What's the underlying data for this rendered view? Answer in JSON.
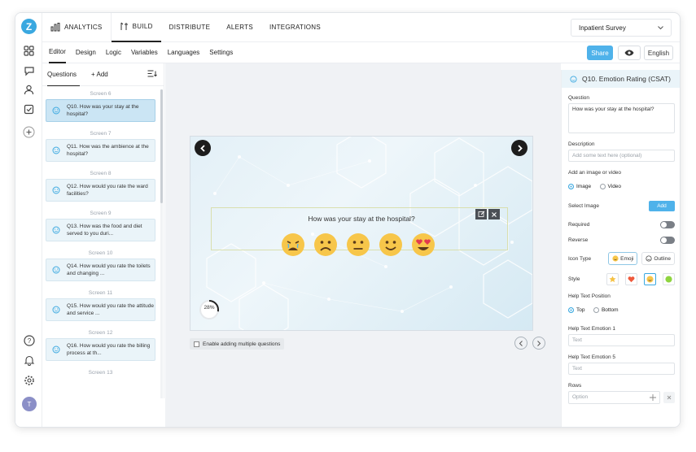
{
  "topnav": {
    "tabs": [
      {
        "label": "ANALYTICS"
      },
      {
        "label": "BUILD"
      },
      {
        "label": "DISTRIBUTE"
      },
      {
        "label": "ALERTS"
      },
      {
        "label": "INTEGRATIONS"
      }
    ],
    "survey_name": "Inpatient Survey"
  },
  "subnav": {
    "tabs": [
      "Editor",
      "Design",
      "Logic",
      "Variables",
      "Languages",
      "Settings"
    ],
    "share_label": "Share",
    "language": "English"
  },
  "questions_panel": {
    "tab_label": "Questions",
    "add_label": "+ Add",
    "items": [
      {
        "screen": "Screen 6",
        "text": "Q10. How was your stay at the hospital?"
      },
      {
        "screen": "Screen 7",
        "text": "Q11. How was the ambience at the hospital?"
      },
      {
        "screen": "Screen 8",
        "text": "Q12. How would you rate the ward facilities?"
      },
      {
        "screen": "Screen 9",
        "text": "Q13. How was the food and diet served to you duri..."
      },
      {
        "screen": "Screen 10",
        "text": "Q14. How would you rate the toilets and changing ..."
      },
      {
        "screen": "Screen 11",
        "text": "Q15. How would you rate the attitude and service ..."
      },
      {
        "screen": "Screen 12",
        "text": "Q16. How would you rate the billing process at th..."
      },
      {
        "screen": "Screen 13",
        "text": ""
      }
    ]
  },
  "preview": {
    "question": "How was your stay at the hospital?",
    "progress_text": "28%",
    "progress": 0.28,
    "multi_label": "Enable adding multiple questions"
  },
  "props": {
    "header": "Q10. Emotion Rating (CSAT)",
    "question_label": "Question",
    "question_value": "How was your stay at the hospital?",
    "description_label": "Description",
    "description_placeholder": "Add some text here (optional)",
    "media_label": "Add an image or video",
    "media_image": "Image",
    "media_video": "Video",
    "select_image_label": "Select Image",
    "add_label": "Add",
    "required_label": "Required",
    "reverse_label": "Reverse",
    "icon_type_label": "Icon Type",
    "icon_emoji": "Emoji",
    "icon_outline": "Outline",
    "style_label": "Style",
    "help_pos_label": "Help Text Position",
    "help_top": "Top",
    "help_bottom": "Bottom",
    "help1_label": "Help Text Emotion 1",
    "help1_placeholder": "Text",
    "help5_label": "Help Text Emotion 5",
    "help5_placeholder": "Text",
    "rows_label": "Rows",
    "option_placeholder": "Option"
  },
  "colors": {
    "accent": "#4fb2ea",
    "active_card": "#cbe5f4",
    "card": "#eaf4f9"
  }
}
